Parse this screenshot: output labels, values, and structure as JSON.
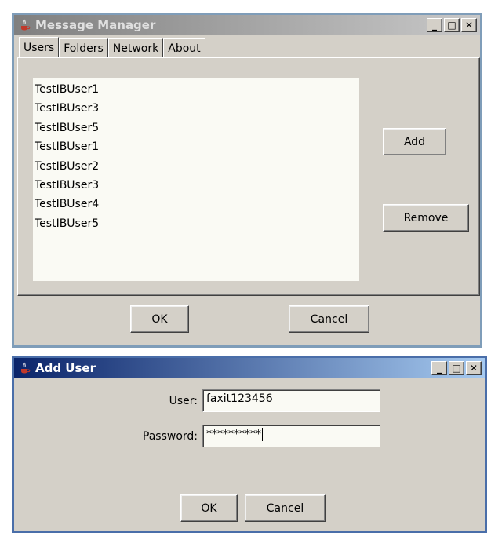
{
  "message_manager": {
    "title": "Message Manager",
    "tabs": [
      "Users",
      "Folders",
      "Network",
      "About"
    ],
    "selected_tab": "Users",
    "users": [
      "TestIBUser1",
      "TestIBUser3",
      "TestIBUser5",
      "TestIBUser1",
      "TestIBUser2",
      "TestIBUser3",
      "TestIBUser4",
      "TestIBUser5"
    ],
    "add_label": "Add",
    "remove_label": "Remove",
    "ok_label": "OK",
    "cancel_label": "Cancel",
    "minimize_glyph": "_",
    "maximize_glyph": "□",
    "close_glyph": "✕"
  },
  "add_user": {
    "title": "Add User",
    "user_label": "User:",
    "user_value": "faxit123456",
    "password_label": "Password:",
    "password_value": "**********",
    "ok_label": "OK",
    "cancel_label": "Cancel",
    "minimize_glyph": "_",
    "maximize_glyph": "□",
    "close_glyph": "✕"
  },
  "colors": {
    "inactive_titlebar": "#808080",
    "active_titlebar": "#0a246a",
    "window_bg": "#d4d0c8",
    "list_bg": "#fafaf4"
  },
  "icons": [
    "java-cup-icon",
    "minimize-icon",
    "maximize-icon",
    "close-icon"
  ]
}
